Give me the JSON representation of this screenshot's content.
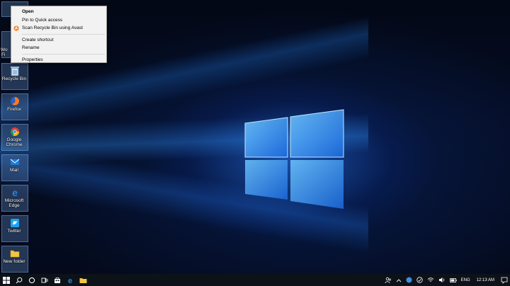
{
  "desktop": {
    "icons": [
      {
        "label": "Recycle Bin",
        "icon": "recycle-bin-icon"
      },
      {
        "label": "Firefox",
        "icon": "firefox-icon"
      },
      {
        "label": "Google Chrome",
        "icon": "chrome-icon"
      },
      {
        "label": "Mail",
        "icon": "mail-icon"
      },
      {
        "label": "Microsoft Edge",
        "icon": "edge-icon"
      },
      {
        "label": "Twitter",
        "icon": "twitter-icon"
      },
      {
        "label": "New folder",
        "icon": "folder-icon"
      }
    ],
    "partial_label": "Wo",
    "partial_label2": "Fi"
  },
  "context_menu": {
    "items": {
      "open": "Open",
      "pin": "Pin to Quick access",
      "scan": "Scan Recycle Bin using Avast",
      "shortcut": "Create shortcut",
      "rename": "Rename",
      "properties": "Properties"
    }
  },
  "taskbar": {
    "buttons": [
      "start-icon",
      "search-icon",
      "task-view-icon",
      "store-icon",
      "edge-icon",
      "file-explorer-icon"
    ],
    "tray": {
      "language": "ENG",
      "time": "12:13 AM"
    }
  },
  "colors": {
    "avast": "#f47b20",
    "taskbar": "#0d1118",
    "menu_bg": "#f2f2f2"
  }
}
